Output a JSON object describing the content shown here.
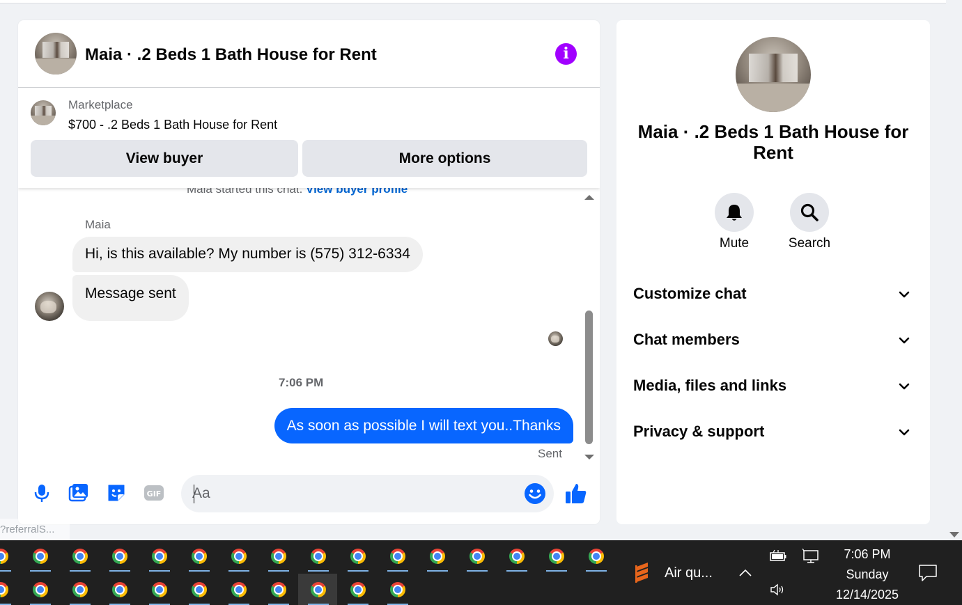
{
  "chat": {
    "title": "Maia · .2 Beds 1 Bath House for Rent",
    "marketplace_label": "Marketplace",
    "listing": "$700 - .2 Beds 1 Bath House for Rent",
    "view_buyer_label": "View buyer",
    "more_options_label": "More options",
    "started_text": "Maia started this chat.",
    "view_buyer_profile_link": "View buyer profile",
    "sender_name": "Maia",
    "messages_in": [
      "Hi, is this available? My number is (575) 312-6334",
      "Message sent"
    ],
    "timestamp": "7:06 PM",
    "message_out": "As soon as possible I will text you..Thanks",
    "sent_label": "Sent",
    "composer_placeholder": "Aa"
  },
  "panel": {
    "title": "Maia · .2 Beds 1 Bath House for Rent",
    "mute_label": "Mute",
    "search_label": "Search",
    "sections": [
      "Customize chat",
      "Chat members",
      "Media, files and links",
      "Privacy & support"
    ]
  },
  "overlay": {
    "preferral_text": "?referralS..."
  },
  "taskbar": {
    "air_label": "Air qu...",
    "time": "7:06 PM",
    "day": "Sunday",
    "date": "12/14/2025"
  },
  "colors": {
    "accent_purple": "#a100ff",
    "outgoing_bubble": "#0866ff",
    "link_blue": "#0064d1",
    "taskbar_bg": "#202020"
  },
  "icons": [
    "info-icon",
    "mic-icon",
    "photo-icon",
    "sticker-icon",
    "gif-icon",
    "emoji-icon",
    "like-icon",
    "bell-icon",
    "search-icon",
    "chevron-down-icon",
    "chrome-icon",
    "air-quality-icon",
    "battery-icon",
    "network-icon",
    "volume-icon",
    "notification-icon"
  ]
}
